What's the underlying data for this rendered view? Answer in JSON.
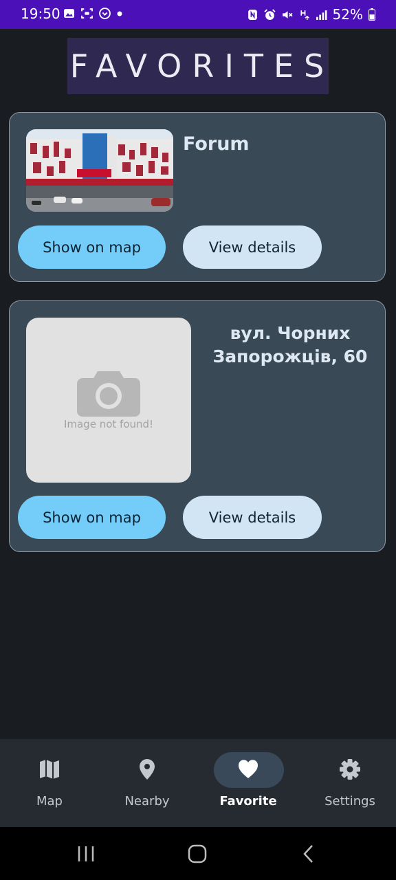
{
  "status_bar": {
    "time": "19:50",
    "battery": "52%",
    "left_icons": [
      "gallery-icon",
      "screenshot-icon",
      "circle-app-icon",
      "dot-icon"
    ],
    "right_icons": [
      "nfc-icon",
      "alarm-icon",
      "mute-icon",
      "network-h-icon",
      "signal-icon",
      "battery-icon"
    ]
  },
  "page": {
    "title": "FAVORITES"
  },
  "favorites": [
    {
      "name": "Forum",
      "image": "building-photo",
      "show_on_map_label": "Show on map",
      "view_details_label": "View details"
    },
    {
      "name": "вул. Чорних Запорожців, 60",
      "image_missing_text": "Image not found!",
      "show_on_map_label": "Show on map",
      "view_details_label": "View details"
    }
  ],
  "bottom_nav": {
    "items": [
      {
        "label": "Map",
        "icon": "map-icon",
        "active": false
      },
      {
        "label": "Nearby",
        "icon": "location-pin-icon",
        "active": false
      },
      {
        "label": "Favorite",
        "icon": "heart-icon",
        "active": true
      },
      {
        "label": "Settings",
        "icon": "gear-icon",
        "active": false
      }
    ]
  },
  "colors": {
    "status_bar": "#4b10b8",
    "background": "#191c20",
    "card": "#394955",
    "primary_button": "#74cdf8",
    "secondary_button": "#d2e5f5",
    "title_box": "#2f2850"
  }
}
